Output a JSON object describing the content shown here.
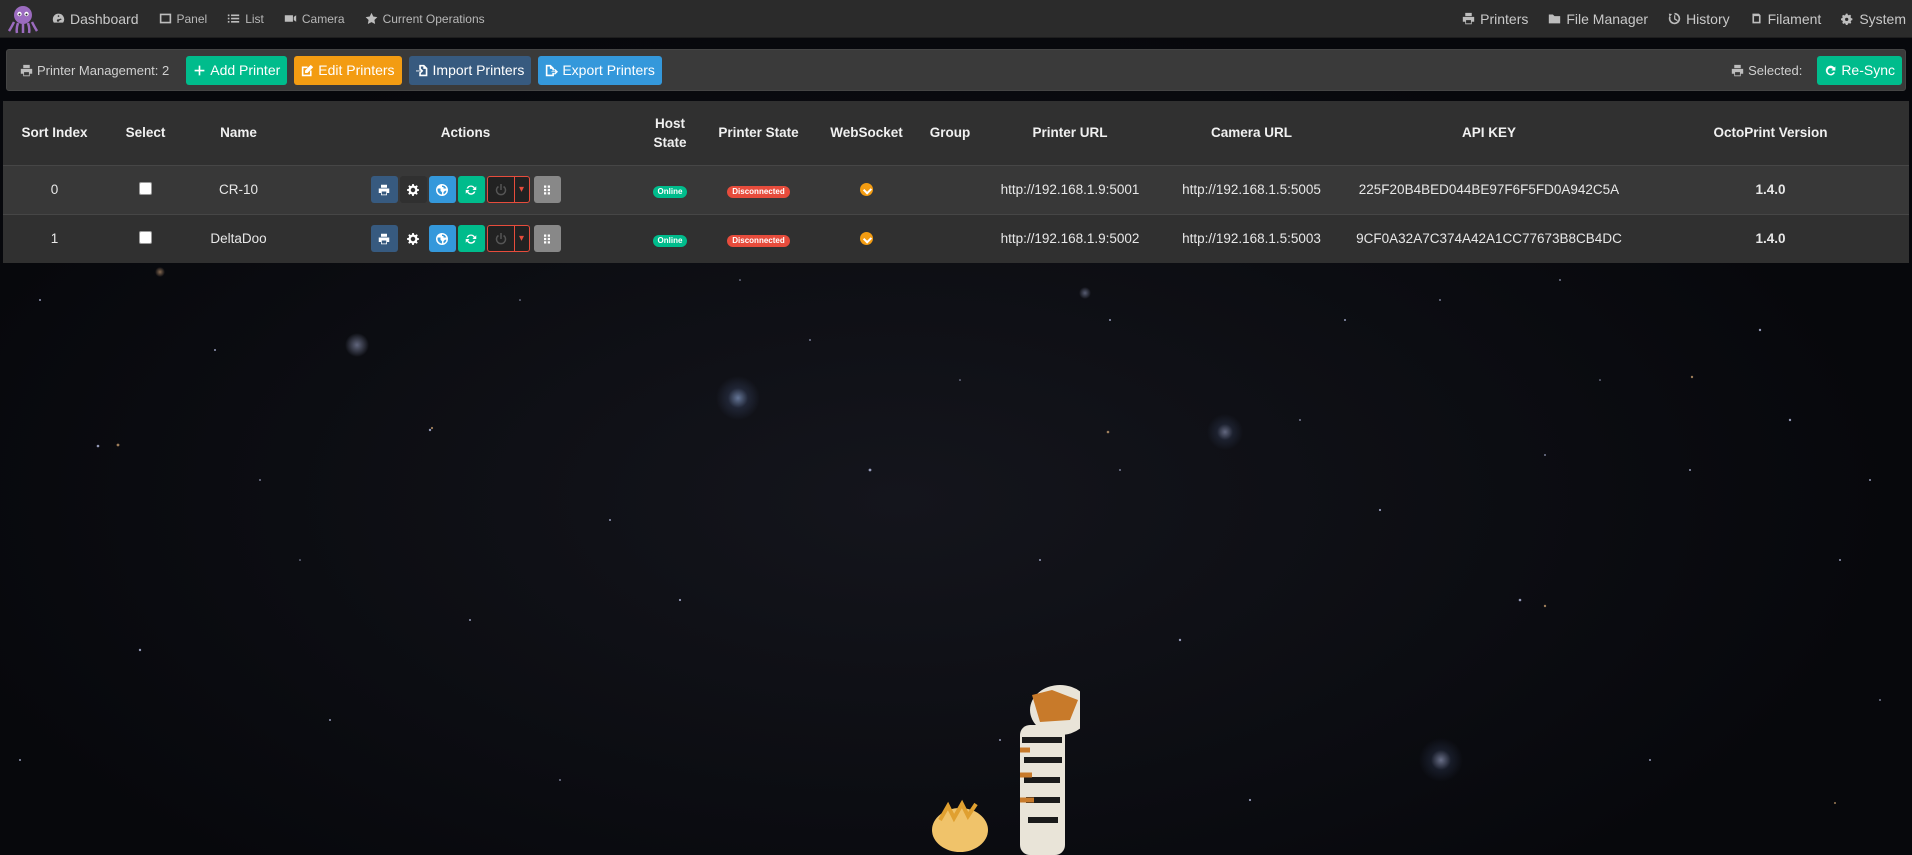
{
  "nav": {
    "left": [
      {
        "label": "Dashboard",
        "icon": "dashboard-icon"
      },
      {
        "label": "Panel",
        "icon": "panel-icon"
      },
      {
        "label": "List",
        "icon": "list-icon"
      },
      {
        "label": "Camera",
        "icon": "camera-icon"
      },
      {
        "label": "Current Operations",
        "icon": "star-icon"
      }
    ],
    "right": [
      {
        "label": "Printers",
        "icon": "printer-icon"
      },
      {
        "label": "File Manager",
        "icon": "folder-icon"
      },
      {
        "label": "History",
        "icon": "history-icon"
      },
      {
        "label": "Filament",
        "icon": "filament-icon"
      },
      {
        "label": "System",
        "icon": "gears-icon"
      }
    ]
  },
  "management": {
    "title": "Printer Management: 2",
    "add_label": "Add Printer",
    "edit_label": "Edit Printers",
    "import_label": "Import Printers",
    "export_label": "Export Printers",
    "selected_label": "Selected:",
    "resync_label": "Re-Sync"
  },
  "table": {
    "headers": {
      "sort_index": "Sort Index",
      "select": "Select",
      "name": "Name",
      "actions": "Actions",
      "host_state_1": "Host",
      "host_state_2": "State",
      "printer_state": "Printer State",
      "websocket": "WebSocket",
      "group": "Group",
      "printer_url": "Printer URL",
      "camera_url": "Camera URL",
      "api_key": "API KEY",
      "octoprint_version": "OctoPrint Version"
    },
    "rows": [
      {
        "sort_index": "0",
        "name": "CR-10",
        "host_state": "Online",
        "printer_state": "Disconnected",
        "group": "",
        "printer_url": "http://192.168.1.9:5001",
        "camera_url": "http://192.168.1.5:5005",
        "api_key": "225F20B4BED044BE97F6F5FD0A942C5A",
        "octoprint_version": "1.4.0"
      },
      {
        "sort_index": "1",
        "name": "DeltaDoo",
        "host_state": "Online",
        "printer_state": "Disconnected",
        "group": "",
        "printer_url": "http://192.168.1.9:5002",
        "camera_url": "http://192.168.1.5:5003",
        "api_key": "9CF0A32A7C374A42A1CC77673B8CB4DC",
        "octoprint_version": "1.4.0"
      }
    ]
  },
  "colors": {
    "success": "#00bc8c",
    "warning": "#f39c12",
    "primary": "#375a7f",
    "info": "#3498db",
    "danger": "#e74c3c"
  }
}
